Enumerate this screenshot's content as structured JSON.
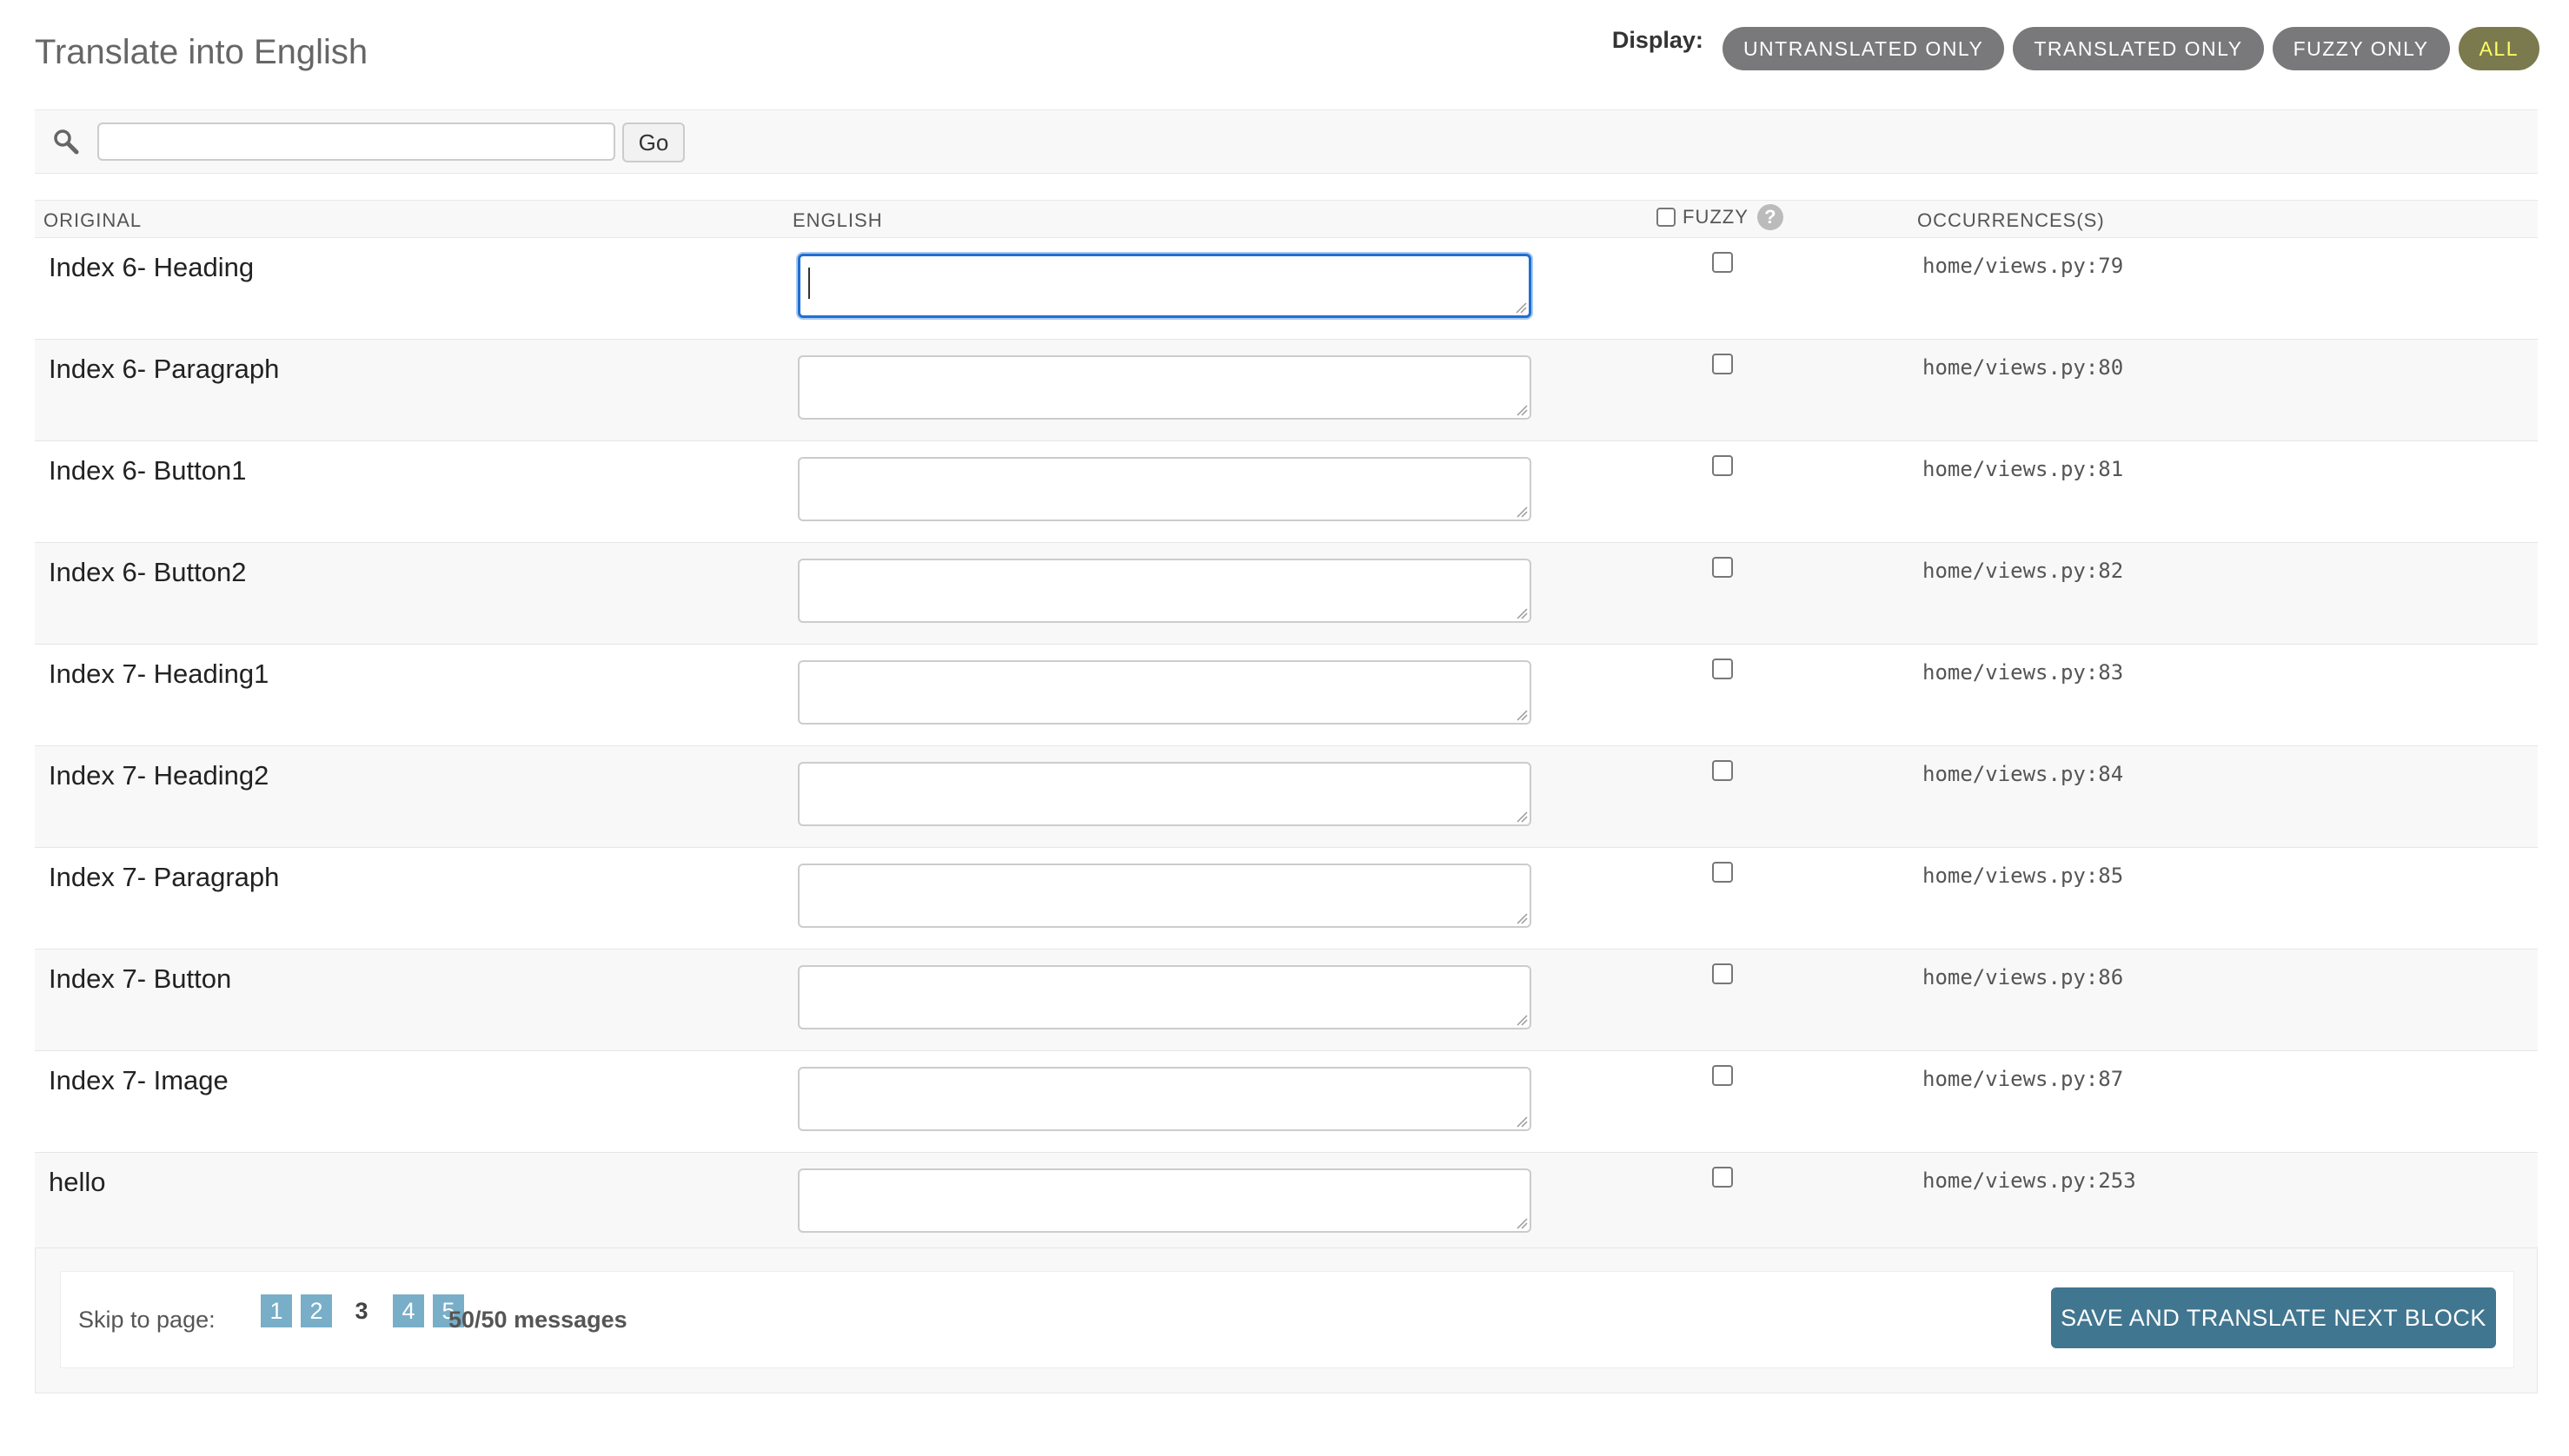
{
  "header": {
    "title": "Translate into English",
    "display_label": "Display:",
    "filters": [
      {
        "label": "UNTRANSLATED ONLY",
        "active": false
      },
      {
        "label": "TRANSLATED ONLY",
        "active": false
      },
      {
        "label": "FUZZY ONLY",
        "active": false
      },
      {
        "label": "ALL",
        "active": true
      }
    ]
  },
  "search": {
    "value": "",
    "go_label": "Go",
    "icon": "search-icon"
  },
  "table": {
    "columns": {
      "original": "ORIGINAL",
      "english": "ENGLISH",
      "fuzzy": "FUZZY",
      "occurrences": "OCCURRENCES(S)"
    },
    "rows": [
      {
        "original": "Index 6- Heading",
        "english": "",
        "fuzzy": false,
        "occurrence": "home/views.py:79"
      },
      {
        "original": "Index 6- Paragraph",
        "english": "",
        "fuzzy": false,
        "occurrence": "home/views.py:80"
      },
      {
        "original": "Index 6- Button1",
        "english": "",
        "fuzzy": false,
        "occurrence": "home/views.py:81"
      },
      {
        "original": "Index 6- Button2",
        "english": "",
        "fuzzy": false,
        "occurrence": "home/views.py:82"
      },
      {
        "original": "Index 7- Heading1",
        "english": "",
        "fuzzy": false,
        "occurrence": "home/views.py:83"
      },
      {
        "original": "Index 7- Heading2",
        "english": "",
        "fuzzy": false,
        "occurrence": "home/views.py:84"
      },
      {
        "original": "Index 7- Paragraph",
        "english": "",
        "fuzzy": false,
        "occurrence": "home/views.py:85"
      },
      {
        "original": "Index 7- Button",
        "english": "",
        "fuzzy": false,
        "occurrence": "home/views.py:86"
      },
      {
        "original": "Index 7- Image",
        "english": "",
        "fuzzy": false,
        "occurrence": "home/views.py:87"
      },
      {
        "original": "hello",
        "english": "",
        "fuzzy": false,
        "occurrence": "home/views.py:253"
      }
    ]
  },
  "footer": {
    "skip_label": "Skip to page:",
    "pages": [
      "1",
      "2",
      "3",
      "4",
      "5"
    ],
    "current_page": "3",
    "message_count": "50/50 messages",
    "save_label": "SAVE AND TRANSLATE NEXT BLOCK"
  },
  "colors": {
    "filter_bg": "#79797c",
    "filter_active_text": "#ffff66",
    "pager_bg": "#79aec8",
    "save_bg": "#417690",
    "focus_border": "#1f6fd1"
  }
}
